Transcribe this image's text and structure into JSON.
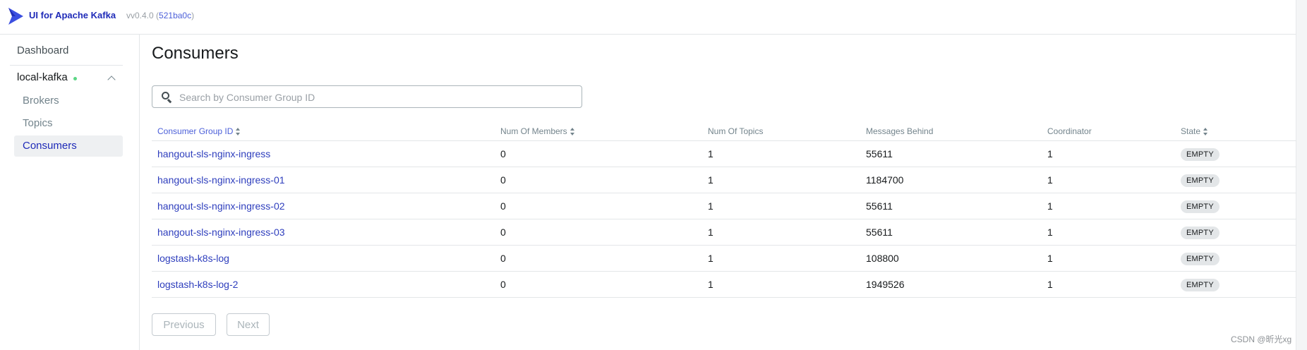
{
  "app": {
    "title": "UI for Apache Kafka",
    "version": "vv0.4.0",
    "commit": "521ba0c",
    "logo_icon": "kafka-bird-logo-icon",
    "brand_color": "#1f2bb8"
  },
  "sidebar": {
    "dashboard_label": "Dashboard",
    "cluster": {
      "name": "local-kafka",
      "status_color": "#5cd685",
      "toggle_icon": "chevron-up-icon"
    },
    "items": [
      {
        "label": "Brokers",
        "active": false
      },
      {
        "label": "Topics",
        "active": false
      },
      {
        "label": "Consumers",
        "active": true
      }
    ]
  },
  "main": {
    "title": "Consumers",
    "search": {
      "placeholder": "Search by Consumer Group ID",
      "value": "",
      "icon": "search-icon"
    },
    "table": {
      "columns": [
        {
          "label": "Consumer Group ID",
          "sortable": true,
          "active": true
        },
        {
          "label": "Num Of Members",
          "sortable": true,
          "active": false
        },
        {
          "label": "Num Of Topics",
          "sortable": false,
          "active": false
        },
        {
          "label": "Messages Behind",
          "sortable": false,
          "active": false
        },
        {
          "label": "Coordinator",
          "sortable": false,
          "active": false
        },
        {
          "label": "State",
          "sortable": true,
          "active": false
        }
      ],
      "rows": [
        {
          "group_id": "hangout-sls-nginx-ingress",
          "members": "0",
          "topics": "1",
          "behind": "55611",
          "coordinator": "1",
          "state": "EMPTY"
        },
        {
          "group_id": "hangout-sls-nginx-ingress-01",
          "members": "0",
          "topics": "1",
          "behind": "1184700",
          "coordinator": "1",
          "state": "EMPTY"
        },
        {
          "group_id": "hangout-sls-nginx-ingress-02",
          "members": "0",
          "topics": "1",
          "behind": "55611",
          "coordinator": "1",
          "state": "EMPTY"
        },
        {
          "group_id": "hangout-sls-nginx-ingress-03",
          "members": "0",
          "topics": "1",
          "behind": "55611",
          "coordinator": "1",
          "state": "EMPTY"
        },
        {
          "group_id": "logstash-k8s-log",
          "members": "0",
          "topics": "1",
          "behind": "108800",
          "coordinator": "1",
          "state": "EMPTY"
        },
        {
          "group_id": "logstash-k8s-log-2",
          "members": "0",
          "topics": "1",
          "behind": "1949526",
          "coordinator": "1",
          "state": "EMPTY"
        }
      ]
    },
    "pagination": {
      "previous_label": "Previous",
      "next_label": "Next"
    }
  },
  "watermark": "CSDN @昕光xg"
}
